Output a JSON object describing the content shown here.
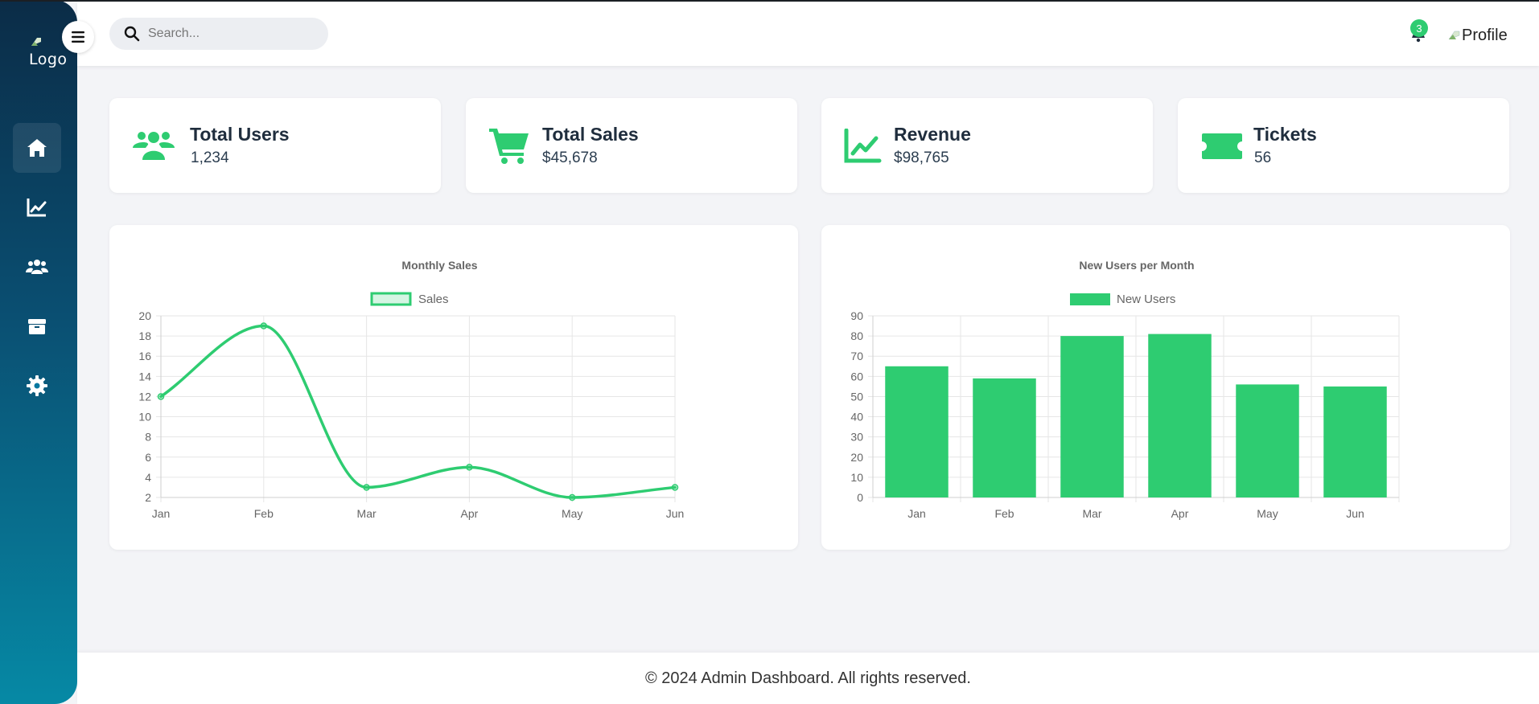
{
  "sidebar": {
    "logo_text": "Logo",
    "items": [
      {
        "icon": "home-icon",
        "active": true
      },
      {
        "icon": "chart-line-icon",
        "active": false
      },
      {
        "icon": "users-icon",
        "active": false
      },
      {
        "icon": "box-icon",
        "active": false
      },
      {
        "icon": "gear-icon",
        "active": false
      }
    ]
  },
  "header": {
    "search_placeholder": "Search...",
    "notification_count": "3",
    "profile_label": "Profile"
  },
  "stats": [
    {
      "title": "Total Users",
      "value": "1,234",
      "icon": "users-icon"
    },
    {
      "title": "Total Sales",
      "value": "$45,678",
      "icon": "cart-icon"
    },
    {
      "title": "Revenue",
      "value": "$98,765",
      "icon": "chart-line-icon"
    },
    {
      "title": "Tickets",
      "value": "56",
      "icon": "ticket-icon"
    }
  ],
  "colors": {
    "accent": "#2ecc71",
    "sidebar_top": "#0b2c47",
    "sidebar_bottom": "#0689a5"
  },
  "chart_data": [
    {
      "type": "line",
      "title": "Monthly Sales",
      "categories": [
        "Jan",
        "Feb",
        "Mar",
        "Apr",
        "May",
        "Jun"
      ],
      "series": [
        {
          "name": "Sales",
          "values": [
            12,
            19,
            3,
            5,
            2,
            3
          ]
        }
      ],
      "ylim": [
        2,
        20
      ],
      "yticks": [
        2,
        4,
        6,
        8,
        10,
        12,
        14,
        16,
        18,
        20
      ],
      "legend": "top",
      "grid": true
    },
    {
      "type": "bar",
      "title": "New Users per Month",
      "categories": [
        "Jan",
        "Feb",
        "Mar",
        "Apr",
        "May",
        "Jun"
      ],
      "series": [
        {
          "name": "New Users",
          "values": [
            65,
            59,
            80,
            81,
            56,
            55
          ]
        }
      ],
      "ylim": [
        0,
        90
      ],
      "yticks": [
        0,
        10,
        20,
        30,
        40,
        50,
        60,
        70,
        80,
        90
      ],
      "legend": "top",
      "grid": true
    }
  ],
  "footer": {
    "text": "© 2024 Admin Dashboard. All rights reserved."
  }
}
